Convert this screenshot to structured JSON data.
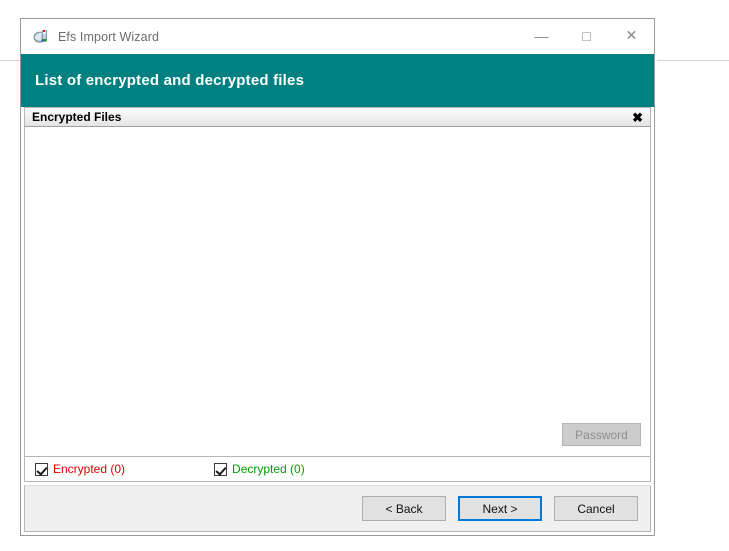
{
  "window": {
    "title": "Efs Import Wizard",
    "app_icon": "computer-monitor-icon",
    "controls": {
      "minimize": "—",
      "maximize": "□",
      "close": "✕"
    }
  },
  "banner": {
    "title": "List of encrypted and decrypted files",
    "color": "#008080"
  },
  "group": {
    "label": "Encrypted Files",
    "close_icon": "✖"
  },
  "file_list": {
    "items": [],
    "password_button": {
      "label": "Password",
      "enabled": false
    }
  },
  "filters": [
    {
      "label": "Encrypted (0)",
      "checked": true,
      "color": "#e00000",
      "name": "encrypted"
    },
    {
      "label": "Decrypted (0)",
      "checked": true,
      "color": "#00a000",
      "name": "decrypted"
    }
  ],
  "footer": {
    "back_label": "< Back",
    "next_label": "Next >",
    "cancel_label": "Cancel",
    "focus_color": "#0078d7"
  }
}
